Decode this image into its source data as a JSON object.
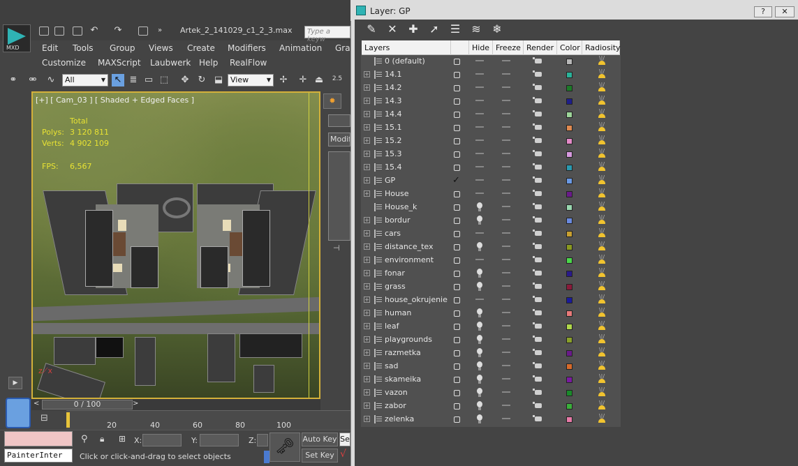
{
  "max": {
    "logo_label": "MXD",
    "file_title": "Artek_2_141029_c1_2_3.max",
    "search_placeholder": "Type a keyw",
    "menu_row1": [
      "Edit",
      "Tools",
      "Group",
      "Views",
      "Create",
      "Modifiers",
      "Animation",
      "Grap"
    ],
    "menu_row2": [
      "Customize",
      "MAXScript",
      "Laubwerk",
      "Help",
      "RealFlow"
    ],
    "selection_filter": "All",
    "ref_coord": "View",
    "viewport": {
      "label": "[+] [ Cam_03 ] [ Shaded + Edged Faces ]",
      "stats_header": "Total",
      "polys_label": "Polys:",
      "polys_value": "3 120 811",
      "verts_label": "Verts:",
      "verts_value": "4 902 109",
      "fps_label": "FPS:",
      "fps_value": "6,567"
    },
    "command_panel_tab": "Modif",
    "timeline": {
      "slider_text": "0 / 100",
      "ticks": [
        "20",
        "40",
        "60",
        "80",
        "100"
      ]
    },
    "status": {
      "maxscript_text": "PainterInter",
      "x_label": "X:",
      "y_label": "Y:",
      "z_label": "Z:",
      "prompt": "Click or click-and-drag to select objects",
      "auto_key": "Auto Key",
      "set_key": "Set Key",
      "se_label": "Se"
    }
  },
  "layer_dialog": {
    "title": "Layer: GP",
    "window_buttons": [
      "?",
      "✕"
    ],
    "columns": [
      "Layers",
      "Hide",
      "Freeze",
      "Render",
      "Color",
      "Radiosity"
    ],
    "layers": [
      {
        "name": "0 (default)",
        "expandable": false,
        "active": false,
        "hide": "dash",
        "color": "#b8b8b8"
      },
      {
        "name": "14.1",
        "expandable": true,
        "active": false,
        "hide": "dash",
        "color": "#2ab39a"
      },
      {
        "name": "14.2",
        "expandable": true,
        "active": false,
        "hide": "dash",
        "color": "#1c7a28"
      },
      {
        "name": "14.3",
        "expandable": true,
        "active": false,
        "hide": "dash",
        "color": "#1e1e8a"
      },
      {
        "name": "14.4",
        "expandable": true,
        "active": false,
        "hide": "dash",
        "color": "#9ed69a"
      },
      {
        "name": "15.1",
        "expandable": true,
        "active": false,
        "hide": "dash",
        "color": "#e08a50"
      },
      {
        "name": "15.2",
        "expandable": true,
        "active": false,
        "hide": "dash",
        "color": "#e48ac8"
      },
      {
        "name": "15.3",
        "expandable": true,
        "active": false,
        "hide": "dash",
        "color": "#d79ae0"
      },
      {
        "name": "15.4",
        "expandable": true,
        "active": false,
        "hide": "dash",
        "color": "#2a9ab0"
      },
      {
        "name": "GP",
        "expandable": true,
        "active": true,
        "hide": "dash",
        "color": "#6a9ae6"
      },
      {
        "name": "House",
        "expandable": true,
        "active": false,
        "hide": "dash",
        "color": "#6a1a8a"
      },
      {
        "name": "House_k",
        "expandable": false,
        "active": false,
        "hide": "bulb",
        "color": "#9ad8b0"
      },
      {
        "name": "bordur",
        "expandable": true,
        "active": false,
        "hide": "bulb",
        "color": "#6a8ae0"
      },
      {
        "name": "cars",
        "expandable": true,
        "active": false,
        "hide": "dash",
        "color": "#c8a030"
      },
      {
        "name": "distance_tex",
        "expandable": true,
        "active": false,
        "hide": "bulb",
        "color": "#8a9a20"
      },
      {
        "name": "environment",
        "expandable": true,
        "active": false,
        "hide": "dash",
        "color": "#4ad84a"
      },
      {
        "name": "fonar",
        "expandable": true,
        "active": false,
        "hide": "bulb",
        "color": "#2a1a8a"
      },
      {
        "name": "grass",
        "expandable": true,
        "active": false,
        "hide": "bulb",
        "color": "#8a1a3a"
      },
      {
        "name": "house_okrujenie",
        "expandable": true,
        "active": false,
        "hide": "dash",
        "color": "#1a1a9a"
      },
      {
        "name": "human",
        "expandable": true,
        "active": false,
        "hide": "bulb",
        "color": "#e87a7a"
      },
      {
        "name": "leaf",
        "expandable": true,
        "active": false,
        "hide": "bulb",
        "color": "#b0d84a"
      },
      {
        "name": "playgrounds",
        "expandable": true,
        "active": false,
        "hide": "bulb",
        "color": "#8aa02a"
      },
      {
        "name": "razmetka",
        "expandable": true,
        "active": false,
        "hide": "bulb",
        "color": "#6a1a8a"
      },
      {
        "name": "sad",
        "expandable": true,
        "active": false,
        "hide": "bulb",
        "color": "#d86a2a"
      },
      {
        "name": "skameika",
        "expandable": true,
        "active": false,
        "hide": "bulb",
        "color": "#7a1aa0"
      },
      {
        "name": "vazon",
        "expandable": true,
        "active": false,
        "hide": "bulb",
        "color": "#1a8a2a"
      },
      {
        "name": "zabor",
        "expandable": true,
        "active": false,
        "hide": "bulb",
        "color": "#3ab03a"
      },
      {
        "name": "zelenka",
        "expandable": true,
        "active": false,
        "hide": "bulb",
        "color": "#e87aa8"
      }
    ]
  }
}
